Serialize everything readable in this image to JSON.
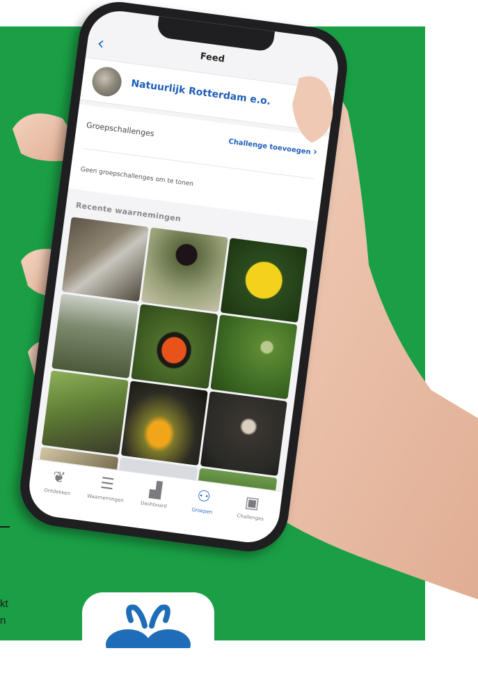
{
  "edge_text": {
    "line1": "kt",
    "line2": "n"
  },
  "phone": {
    "nav": {
      "back_icon": "chevron-left-icon",
      "title": "Feed"
    },
    "group": {
      "name": "Natuurlijk Rotterdam e.o.",
      "chevron_icon": "chevron-right-icon"
    },
    "challenges": {
      "title": "Groepschallenges",
      "add_label": "Challenge toevoegen",
      "empty_text": "Geen groepschallenges om te tonen"
    },
    "recent": {
      "title": "Recente waarnemingen"
    },
    "tabs": [
      {
        "label": "Ontdekken",
        "icon": "species-icon",
        "active": false
      },
      {
        "label": "Waarnemingen",
        "icon": "list-icon",
        "active": false
      },
      {
        "label": "Dashboard",
        "icon": "chart-icon",
        "active": false
      },
      {
        "label": "Groepen",
        "icon": "groups-icon",
        "active": true
      },
      {
        "label": "Challenges",
        "icon": "challenge-icon",
        "active": false
      }
    ]
  },
  "colors": {
    "background": "#1a9f45",
    "accent": "#2a6cc6",
    "link": "#1e5fb8"
  }
}
